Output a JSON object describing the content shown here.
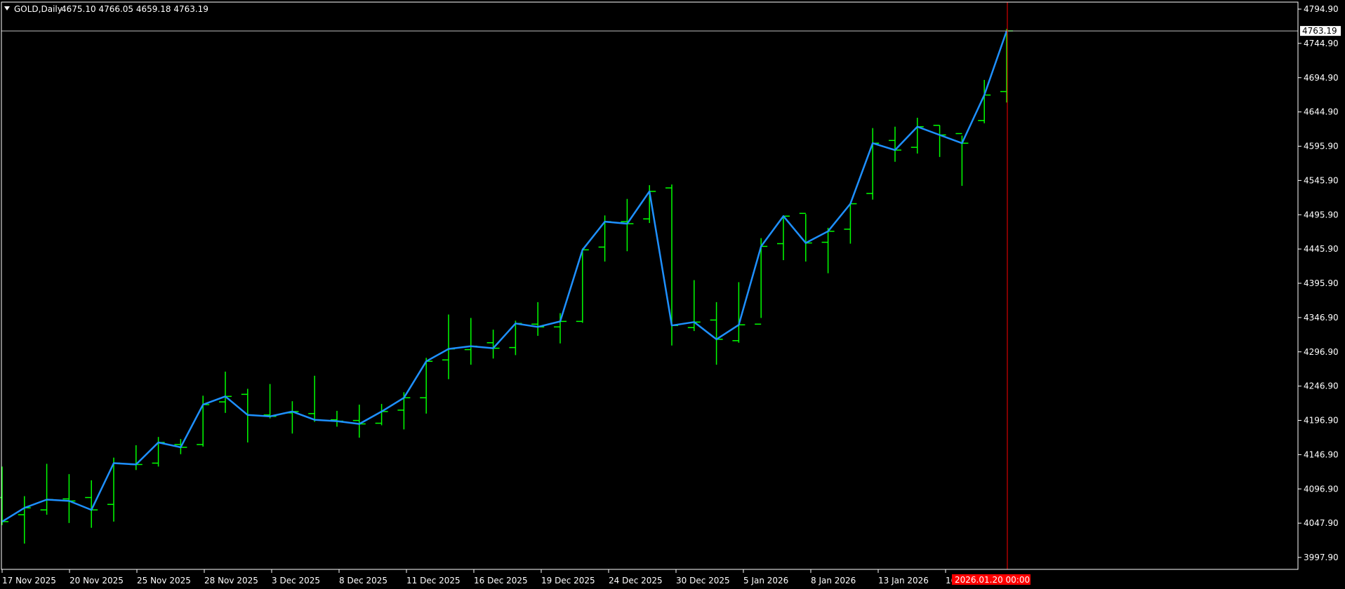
{
  "header": {
    "symbol": "GOLD,Daily",
    "ohlc": "4675.10 4766.05 4659.18 4763.19"
  },
  "price_axis": {
    "ticks": [
      "4794.90",
      "4744.90",
      "4694.90",
      "4644.90",
      "4595.90",
      "4545.90",
      "4495.90",
      "4445.90",
      "4395.90",
      "4346.90",
      "4296.90",
      "4246.90",
      "4196.90",
      "4146.90",
      "4096.90",
      "4047.90",
      "3997.90"
    ],
    "current_price_label": "4763.19"
  },
  "time_axis": {
    "labels": [
      "17 Nov 2025",
      "20 Nov 2025",
      "25 Nov 2025",
      "28 Nov 2025",
      "3 Dec 2025",
      "8 Dec 2025",
      "11 Dec 2025",
      "16 Dec 2025",
      "19 Dec 2025",
      "24 Dec 2025",
      "30 Dec 2025",
      "5 Jan 2026",
      "8 Jan 2026",
      "13 Jan 2026",
      "16"
    ],
    "crosshair_label": "2026.01.20 00:00"
  },
  "colors": {
    "background": "#000000",
    "axis_line": "#ffffff",
    "bars": "#00ff00",
    "line": "#1e90ff",
    "price_line": "#c0c0c0",
    "crosshair": "#ff0000"
  },
  "chart_data": {
    "type": "ohlc_bars_with_close_line",
    "symbol": "GOLD",
    "timeframe": "Daily",
    "ylim": [
      3990,
      4800
    ],
    "bars": [
      {
        "date": "14 Nov 2025",
        "open": 4085,
        "high": 4130,
        "low": 4045,
        "close": 4050
      },
      {
        "date": "17 Nov 2025",
        "open": 4060,
        "high": 4087,
        "low": 4018,
        "close": 4070
      },
      {
        "date": "18 Nov 2025",
        "open": 4067,
        "high": 4134,
        "low": 4060,
        "close": 4082
      },
      {
        "date": "19 Nov 2025",
        "open": 4083,
        "high": 4119,
        "low": 4048,
        "close": 4080
      },
      {
        "date": "20 Nov 2025",
        "open": 4085,
        "high": 4110,
        "low": 4041,
        "close": 4067
      },
      {
        "date": "21 Nov 2025",
        "open": 4075,
        "high": 4143,
        "low": 4050,
        "close": 4135
      },
      {
        "date": "24 Nov 2025",
        "open": 4133,
        "high": 4161,
        "low": 4125,
        "close": 4133
      },
      {
        "date": "25 Nov 2025",
        "open": 4135,
        "high": 4173,
        "low": 4130,
        "close": 4165
      },
      {
        "date": "26 Nov 2025",
        "open": 4162,
        "high": 4170,
        "low": 4148,
        "close": 4158
      },
      {
        "date": "27 Nov 2025",
        "open": 4162,
        "high": 4233,
        "low": 4159,
        "close": 4220
      },
      {
        "date": "28 Nov 2025",
        "open": 4224,
        "high": 4268,
        "low": 4208,
        "close": 4232
      },
      {
        "date": "1 Dec 2025",
        "open": 4235,
        "high": 4243,
        "low": 4165,
        "close": 4205
      },
      {
        "date": "2 Dec 2025",
        "open": 4205,
        "high": 4250,
        "low": 4200,
        "close": 4203
      },
      {
        "date": "3 Dec 2025",
        "open": 4208,
        "high": 4225,
        "low": 4178,
        "close": 4210
      },
      {
        "date": "4 Dec 2025",
        "open": 4207,
        "high": 4262,
        "low": 4195,
        "close": 4198
      },
      {
        "date": "5 Dec 2025",
        "open": 4198,
        "high": 4211,
        "low": 4188,
        "close": 4196
      },
      {
        "date": "8 Dec 2025",
        "open": 4197,
        "high": 4220,
        "low": 4172,
        "close": 4192
      },
      {
        "date": "9 Dec 2025",
        "open": 4193,
        "high": 4221,
        "low": 4190,
        "close": 4210
      },
      {
        "date": "10 Dec 2025",
        "open": 4212,
        "high": 4238,
        "low": 4184,
        "close": 4230
      },
      {
        "date": "11 Dec 2025",
        "open": 4230,
        "high": 4288,
        "low": 4207,
        "close": 4283
      },
      {
        "date": "12 Dec 2025",
        "open": 4285,
        "high": 4351,
        "low": 4257,
        "close": 4301
      },
      {
        "date": "15 Dec 2025",
        "open": 4300,
        "high": 4346,
        "low": 4278,
        "close": 4305
      },
      {
        "date": "16 Dec 2025",
        "open": 4310,
        "high": 4329,
        "low": 4287,
        "close": 4302
      },
      {
        "date": "17 Dec 2025",
        "open": 4303,
        "high": 4342,
        "low": 4292,
        "close": 4338
      },
      {
        "date": "18 Dec 2025",
        "open": 4337,
        "high": 4369,
        "low": 4320,
        "close": 4333
      },
      {
        "date": "19 Dec 2025",
        "open": 4333,
        "high": 4353,
        "low": 4309,
        "close": 4341
      },
      {
        "date": "22 Dec 2025",
        "open": 4341,
        "high": 4447,
        "low": 4339,
        "close": 4445
      },
      {
        "date": "23 Dec 2025",
        "open": 4449,
        "high": 4495,
        "low": 4428,
        "close": 4486
      },
      {
        "date": "24 Dec 2025",
        "open": 4486,
        "high": 4519,
        "low": 4443,
        "close": 4483
      },
      {
        "date": "25 Dec 2025",
        "open": 4490,
        "high": 4539,
        "low": 4484,
        "close": 4530
      },
      {
        "date": "26 Dec 2025",
        "open": 4535,
        "high": 4540,
        "low": 4306,
        "close": 4335
      },
      {
        "date": "29 Dec 2025",
        "open": 4332,
        "high": 4401,
        "low": 4327,
        "close": 4340
      },
      {
        "date": "30 Dec 2025",
        "open": 4343,
        "high": 4369,
        "low": 4278,
        "close": 4315
      },
      {
        "date": "31 Dec 2025",
        "open": 4313,
        "high": 4398,
        "low": 4310,
        "close": 4336
      },
      {
        "date": "2 Jan 2026",
        "open": 4337,
        "high": 4462,
        "low": 4346,
        "close": 4450
      },
      {
        "date": "5 Jan 2026",
        "open": 4454,
        "high": 4495,
        "low": 4430,
        "close": 4494
      },
      {
        "date": "6 Jan 2026",
        "open": 4498,
        "high": 4497,
        "low": 4428,
        "close": 4455
      },
      {
        "date": "7 Jan 2026",
        "open": 4456,
        "high": 4477,
        "low": 4411,
        "close": 4472
      },
      {
        "date": "8 Jan 2026",
        "open": 4475,
        "high": 4513,
        "low": 4454,
        "close": 4512
      },
      {
        "date": "9 Jan 2026",
        "open": 4527,
        "high": 4622,
        "low": 4518,
        "close": 4600
      },
      {
        "date": "12 Jan 2026",
        "open": 4604,
        "high": 4624,
        "low": 4573,
        "close": 4590
      },
      {
        "date": "13 Jan 2026",
        "open": 4594,
        "high": 4637,
        "low": 4585,
        "close": 4624
      },
      {
        "date": "14 Jan 2026",
        "open": 4626,
        "high": 4626,
        "low": 4580,
        "close": 4612
      },
      {
        "date": "15 Jan 2026",
        "open": 4614,
        "high": 4611,
        "low": 4538,
        "close": 4600
      },
      {
        "date": "16 Jan 2026",
        "open": 4633,
        "high": 4692,
        "low": 4629,
        "close": 4670
      },
      {
        "date": "19 Jan 2026",
        "open": 4675.1,
        "high": 4766.05,
        "low": 4659.18,
        "close": 4763.19
      }
    ]
  }
}
